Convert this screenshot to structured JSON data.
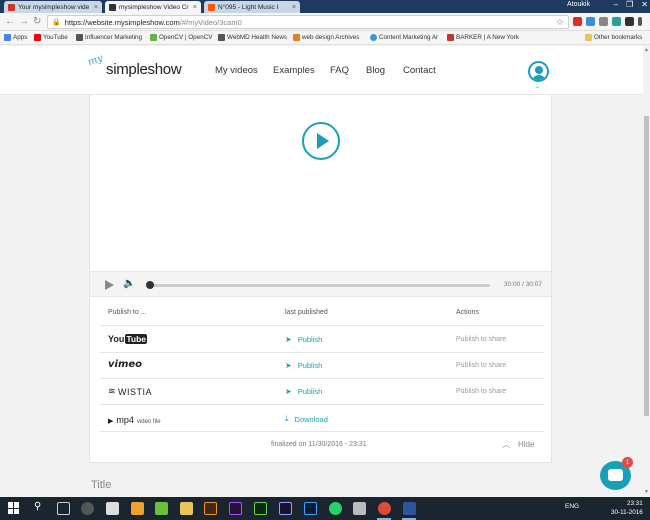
{
  "browser": {
    "tabs": [
      {
        "label": "Your mysimpleshow vide",
        "active": false,
        "favicon_color": "#d93025"
      },
      {
        "label": "mysimpleshow Video Cr",
        "active": true,
        "favicon_color": "#333333"
      },
      {
        "label": "N°095 - Light Music I",
        "active": false,
        "favicon_color": "#ff5500"
      }
    ],
    "user": "Atoukik",
    "url_host": "https://website.mysimpleshow.com",
    "url_path": "/#/myVideo/3cam0",
    "bookmarks": [
      {
        "label": "Apps",
        "color": "#4285f4"
      },
      {
        "label": "YouTube",
        "color": "#ff0000"
      },
      {
        "label": "Influencer Marketing",
        "color": "#555555"
      },
      {
        "label": "OpenCV | OpenCV",
        "color": "#6ab04c"
      },
      {
        "label": "WebMD Health News",
        "color": "#555555"
      },
      {
        "label": "web design Archives",
        "color": "#e67e22"
      },
      {
        "label": "Content Marketing Ar",
        "color": "#3498db"
      },
      {
        "label": "BARKER | A New York",
        "color": "#c0392b"
      }
    ],
    "other_bookmarks": "Other bookmarks"
  },
  "site": {
    "logo_my": "my",
    "logo_brand": "simpleshow",
    "nav": [
      "My videos",
      "Examples",
      "FAQ",
      "Blog",
      "Contact"
    ]
  },
  "player": {
    "time": "30:00 / 30:07",
    "progress": 0.0
  },
  "publish": {
    "headers": {
      "publish_to": "Publish to ...",
      "last_published": "last published",
      "actions": "Actions"
    },
    "rows": [
      {
        "platform": "YouTube",
        "action": "Publish",
        "share": "Publish to share"
      },
      {
        "platform": "vimeo",
        "action": "Publish",
        "share": "Publish to share"
      },
      {
        "platform": "WISTIA",
        "action": "Publish",
        "share": "Publish to share"
      },
      {
        "platform": "mp4",
        "platform_sub": "video file",
        "action": "Download",
        "share": ""
      }
    ],
    "finalized": "finalized on 11/30/2016 - 23:31",
    "hide": "Hide"
  },
  "title_label": "Title",
  "chat": {
    "badge": "1"
  },
  "taskbar": {
    "tray_lang": "ENG",
    "time": "23:31",
    "date": "30-11-2016"
  }
}
